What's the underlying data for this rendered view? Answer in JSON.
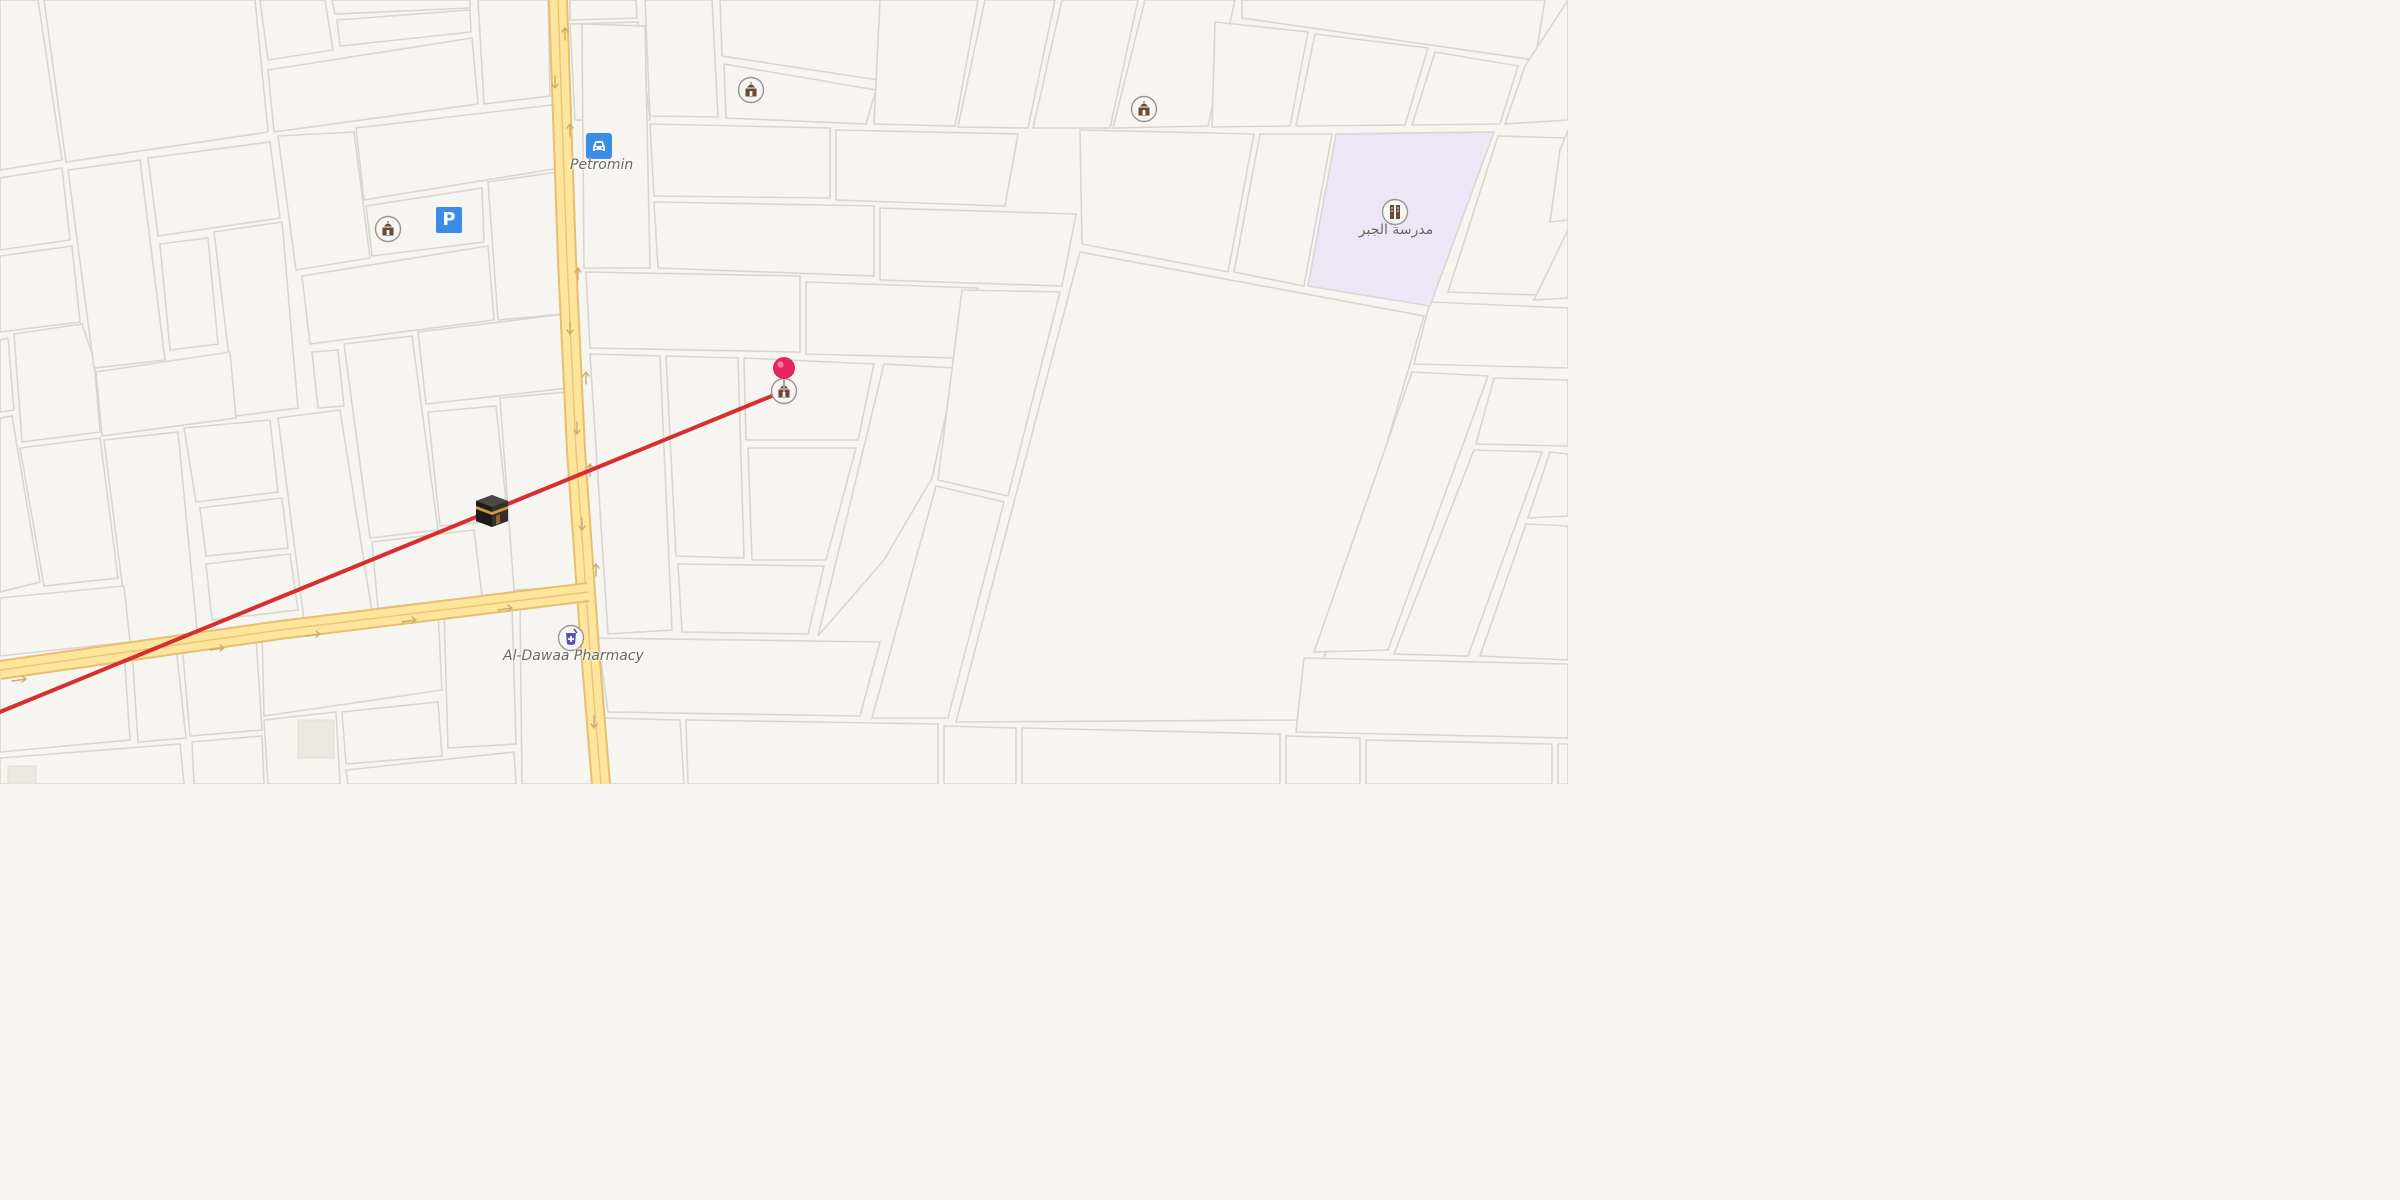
{
  "map": {
    "colors": {
      "background": "#f7f5f2",
      "major_road": "#fde59b",
      "qibla_line": "#d62f2f",
      "pin": "#e8245e",
      "school_area": "#ece6f7",
      "poi_blue": "#3b8ee8"
    },
    "labels": {
      "petromin": "Petromin",
      "pharmacy": "Al-Dawaa Pharmacy",
      "school": "مدرسة الجبر"
    },
    "pois": [
      {
        "kind": "mosque",
        "icon": "mosque-icon"
      },
      {
        "kind": "mosque",
        "icon": "mosque-icon"
      },
      {
        "kind": "mosque",
        "icon": "mosque-icon"
      },
      {
        "kind": "parking",
        "icon": "parking-icon",
        "text": "P"
      },
      {
        "kind": "car-service",
        "icon": "car-icon"
      },
      {
        "kind": "pharmacy",
        "icon": "pharmacy-icon"
      },
      {
        "kind": "school",
        "icon": "school-icon"
      },
      {
        "kind": "selected-mosque",
        "icon": "mosque-icon"
      }
    ],
    "qibla": {
      "icon": "kaaba-icon"
    },
    "pin": {
      "icon": "location-pin-icon"
    }
  }
}
